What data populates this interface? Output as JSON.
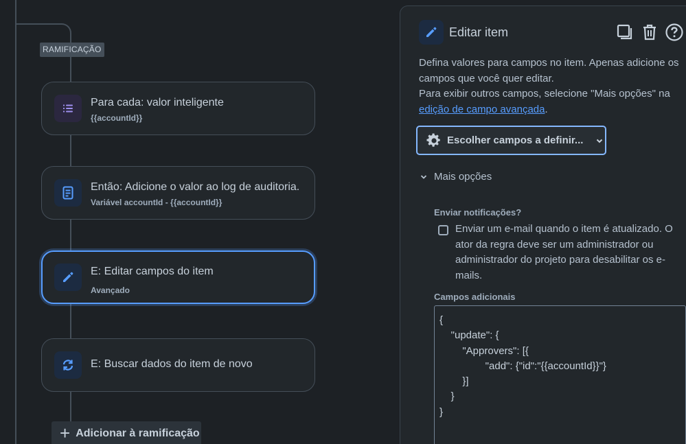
{
  "flow": {
    "branch_label": "RAMIFICAÇÃO",
    "cards": [
      {
        "title": "Para cada: valor inteligente",
        "subtitle": "{{accountId}}",
        "icon": "list-icon"
      },
      {
        "title": "Então: Adicione o valor ao log de auditoria.",
        "subtitle": "Variável accountId - {{accountId}}",
        "icon": "document-icon"
      },
      {
        "title": "E: Editar campos do item",
        "subtitle": "Avançado",
        "icon": "pencil-icon",
        "selected": true
      },
      {
        "title": "E: Buscar dados do item de novo",
        "icon": "refresh-icon"
      }
    ],
    "add_branch_label": "Adicionar à ramificação"
  },
  "panel": {
    "title": "Editar item",
    "desc_line1": "Defina valores para campos no item. Apenas adicione os campos que você quer editar.",
    "desc_line2": "Para exibir outros campos, selecione \"Mais opções\" na ",
    "desc_link": "edição de campo avançada",
    "desc_end": ".",
    "choose_button": "Escolher campos a definir...",
    "more_options": "Mais opções",
    "notifications_label": "Enviar notificações?",
    "notifications_checkbox": "Enviar um e-mail quando o item é atualizado. O ator da regra deve ser um administrador ou administrador do projeto para desabilitar os e-mails.",
    "notifications_checked": false,
    "additional_fields_label": "Campos adicionais",
    "additional_fields_value": "{\n    \"update\": {\n        \"Approvers\": [{\n                \"add\": {\"id\":\"{{accountId}}\"}\n        }]\n    }\n}"
  },
  "colors": {
    "background": "#1d2125",
    "accent": "#579dff",
    "card_border": "#454f59"
  }
}
